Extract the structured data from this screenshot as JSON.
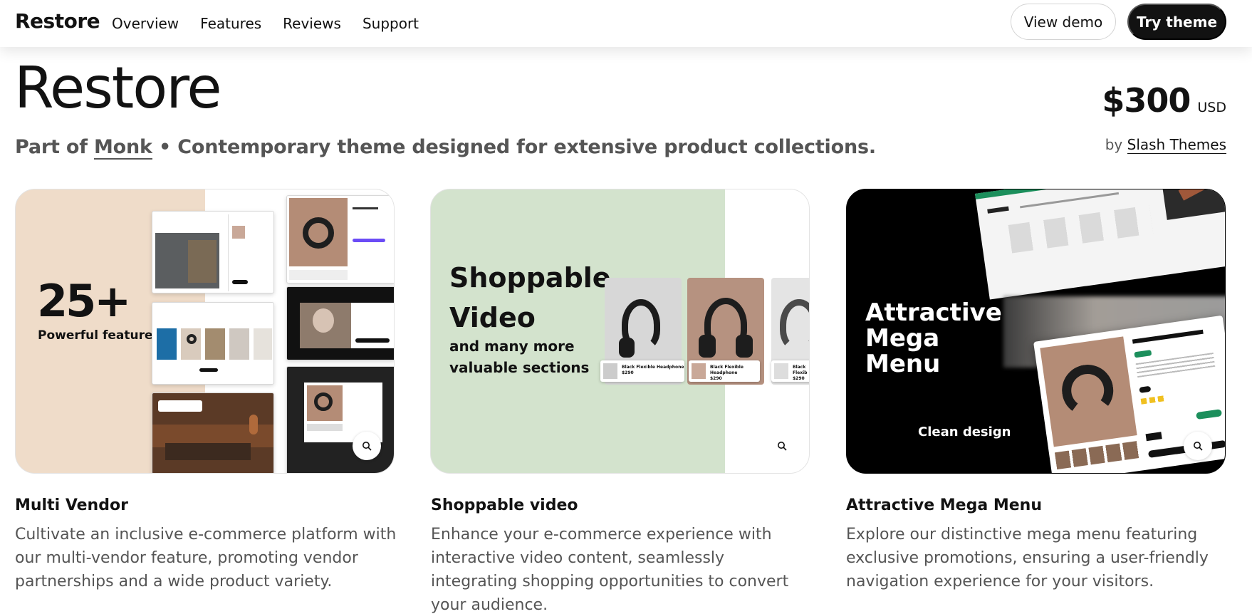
{
  "header": {
    "logo": "Restore",
    "nav": [
      "Overview",
      "Features",
      "Reviews",
      "Support"
    ],
    "view_demo": "View demo",
    "try_theme": "Try theme"
  },
  "hero": {
    "title": "Restore",
    "subtitle_prefix": "Part of",
    "subtitle_link": "Monk",
    "subtitle_rest": "• Contemporary theme designed for extensive product collections.",
    "price": "$300",
    "currency": "USD",
    "by_prefix": "by",
    "author": "Slash Themes"
  },
  "cards": [
    {
      "overlay_big": "25+",
      "overlay_small": "Powerful features",
      "title": "Multi Vendor",
      "description": "Cultivate an inclusive e-commerce platform with our multi-vendor feature, promoting vendor partnerships and a wide product variety."
    },
    {
      "overlay_big": "Shoppable Video",
      "overlay_small": "and many more valuable sections",
      "video_tags": [
        {
          "name": "Black Flexible Headphone",
          "price": "$290"
        },
        {
          "name": "Black Flexible Headphone",
          "price": "$290"
        },
        {
          "name": "Black Flexib",
          "price": "$290"
        }
      ],
      "title": "Shoppable video",
      "description": "Enhance your e-commerce experience with interactive video content, seamlessly integrating shopping opportunities to convert your audience."
    },
    {
      "overlay_big": "Attractive Mega Menu",
      "overlay_small": "Clean design",
      "title": "Attractive Mega Menu",
      "description": "Explore our distinctive mega menu featuring exclusive promotions, ensuring a user-friendly navigation experience for your visitors."
    }
  ],
  "icons": {
    "zoom": "magnifier-icon"
  }
}
